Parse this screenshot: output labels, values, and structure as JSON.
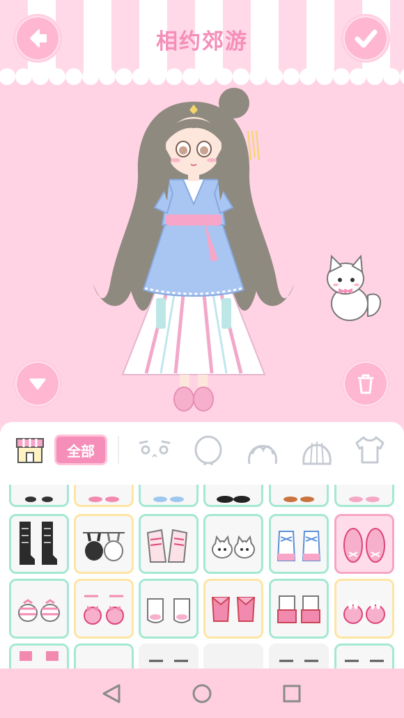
{
  "header": {
    "title": "相约郊游"
  },
  "buttons": {
    "back_icon": "arrow-left-icon",
    "confirm_icon": "check-icon",
    "collapse_icon": "chevron-down-icon",
    "trash_icon": "trash-icon"
  },
  "categories": {
    "shop_icon": "shop-icon",
    "all_label": "全部",
    "items": [
      {
        "name": "eyes",
        "icon": "face-eyes-icon"
      },
      {
        "name": "head",
        "icon": "head-icon"
      },
      {
        "name": "front-hair",
        "icon": "front-hair-icon"
      },
      {
        "name": "back-hair",
        "icon": "back-hair-icon"
      },
      {
        "name": "top",
        "icon": "tshirt-icon"
      }
    ]
  },
  "shoes": {
    "rows": [
      [
        "black-sandals",
        "pink-flats",
        "blue-shoes",
        "black-shoes",
        "brown-shoes",
        "pink-shoes"
      ],
      [
        "black-boots",
        "bunny-slippers",
        "sneakers-pink",
        "cat-shoes-white",
        "sneakers-blue",
        "pink-ballet-flats"
      ],
      [
        "pink-sandals",
        "bow-sandals",
        "white-mary-janes",
        "pink-bow-shoes",
        "pink-booties",
        "bunny-flats-pink"
      ],
      [
        "pink-sandals-2",
        "empty",
        "white-shoes",
        "empty",
        "white-sneakers",
        "white-shoes-2"
      ]
    ],
    "selected": "pink-ballet-flats"
  },
  "colors": {
    "accent": "#f58eb8",
    "background": "#ffd3e4",
    "border_green": "#a3e8d3",
    "border_yellow": "#fde5a2",
    "border_selected": "#f6a6c5"
  },
  "navbar": {
    "back_icon": "triangle-back-icon",
    "home_icon": "circle-home-icon",
    "recents_icon": "square-recents-icon"
  }
}
